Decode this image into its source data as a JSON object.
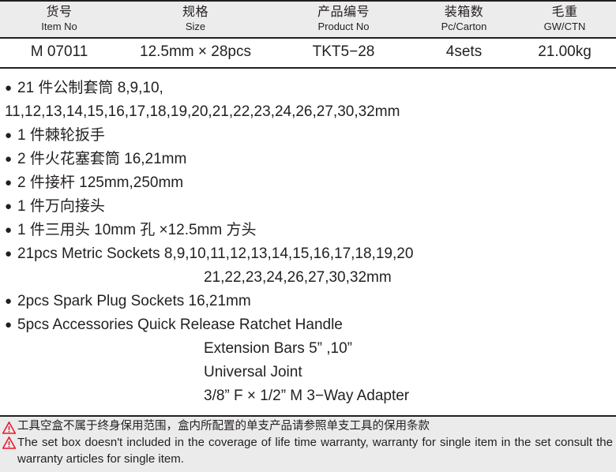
{
  "table": {
    "columns": [
      {
        "cn": "货号",
        "en": "Item No"
      },
      {
        "cn": "规格",
        "en": "Size"
      },
      {
        "cn": "产品编号",
        "en": "Product No"
      },
      {
        "cn": "装箱数",
        "en": "Pc/Carton"
      },
      {
        "cn": "毛重",
        "en": "GW/CTN"
      }
    ],
    "row": {
      "item_no": "M 07011",
      "size": "12.5mm × 28pcs",
      "product_no": "TKT5−28",
      "pc_carton": "4sets",
      "gw_ctn": "21.00kg"
    }
  },
  "bullet_symbol": "●",
  "contents": {
    "lines": [
      {
        "type": "bullet",
        "text": "21 件公制套筒 8,9,10,"
      },
      {
        "type": "continuation",
        "text": "11,12,13,14,15,16,17,18,19,20,21,22,23,24,26,27,30,32mm"
      },
      {
        "type": "bullet",
        "text": "1 件棘轮扳手"
      },
      {
        "type": "bullet",
        "text": "2 件火花塞套筒 16,21mm"
      },
      {
        "type": "bullet",
        "text": "2 件接杆 125mm,250mm"
      },
      {
        "type": "bullet",
        "text": "1 件万向接头"
      },
      {
        "type": "bullet",
        "text": "1 件三用头 10mm 孔 ×12.5mm 方头"
      },
      {
        "type": "bullet",
        "text": "21pcs Metric Sockets 8,9,10,11,12,13,14,15,16,17,18,19,20"
      },
      {
        "type": "sub",
        "text": "21,22,23,24,26,27,30,32mm"
      },
      {
        "type": "bullet",
        "text": "2pcs Spark Plug Sockets 16,21mm"
      },
      {
        "type": "bullet",
        "text": "5pcs Accessories  Quick Release Ratchet Handle"
      },
      {
        "type": "sub",
        "text": "Extension Bars 5” ,10”"
      },
      {
        "type": "sub",
        "text": "Universal Joint"
      },
      {
        "type": "sub",
        "text": "3/8” F × 1/2” M 3−Way Adapter"
      }
    ]
  },
  "footer": {
    "warning_icon": "warning-triangle-icon",
    "warning_color": "#e8192c",
    "cn_notice": "工具空盒不属于终身保用范围，盒内所配置的单支产品请参照单支工具的保用条款",
    "en_notice": "The set box doesn't  included in the coverage of life time warranty, warranty for single item in the set consult the warranty articles for single item."
  }
}
